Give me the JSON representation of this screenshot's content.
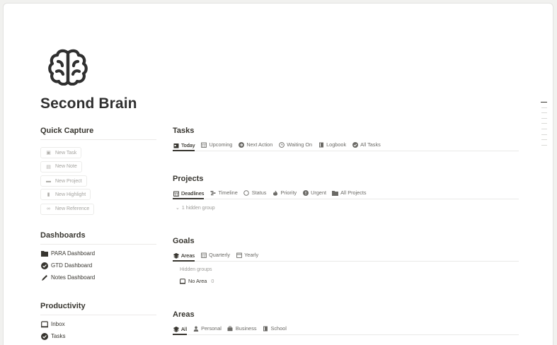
{
  "page": {
    "title": "Second Brain"
  },
  "quick_capture": {
    "heading": "Quick Capture",
    "buttons": [
      {
        "label": "New Task",
        "icon": "checkbox-icon"
      },
      {
        "label": "New Note",
        "icon": "note-icon"
      },
      {
        "label": "New Project",
        "icon": "folder-icon"
      },
      {
        "label": "New Highlight",
        "icon": "bookmark-icon"
      },
      {
        "label": "New Reference",
        "icon": "link-icon"
      }
    ]
  },
  "dashboards": {
    "heading": "Dashboards",
    "items": [
      {
        "label": "PARA Dashboard",
        "icon": "folder-icon"
      },
      {
        "label": "GTD Dashboard",
        "icon": "check-circle-icon"
      },
      {
        "label": "Notes Dashboard",
        "icon": "pencil-icon"
      }
    ]
  },
  "productivity": {
    "heading": "Productivity",
    "items": [
      {
        "label": "Inbox",
        "icon": "inbox-icon"
      },
      {
        "label": "Tasks",
        "icon": "check-circle-icon"
      }
    ]
  },
  "tasks": {
    "title": "Tasks",
    "tabs": [
      {
        "label": "Today",
        "icon": "calendar-icon",
        "active": true
      },
      {
        "label": "Upcoming",
        "icon": "calendar-grid-icon"
      },
      {
        "label": "Next Action",
        "icon": "arrow-circle-icon"
      },
      {
        "label": "Waiting On",
        "icon": "clock-icon"
      },
      {
        "label": "Logbook",
        "icon": "book-icon"
      },
      {
        "label": "All Tasks",
        "icon": "check-circle-icon"
      }
    ]
  },
  "projects": {
    "title": "Projects",
    "tabs": [
      {
        "label": "Deadlines",
        "icon": "calendar-grid-icon",
        "active": true
      },
      {
        "label": "Timeline",
        "icon": "timeline-icon"
      },
      {
        "label": "Status",
        "icon": "circle-icon"
      },
      {
        "label": "Priority",
        "icon": "fire-icon"
      },
      {
        "label": "Urgent",
        "icon": "alert-icon"
      },
      {
        "label": "All Projects",
        "icon": "folder-icon"
      }
    ],
    "hidden_group": "1 hidden group"
  },
  "goals": {
    "title": "Goals",
    "tabs": [
      {
        "label": "Areas",
        "icon": "layers-icon",
        "active": true
      },
      {
        "label": "Quarterly",
        "icon": "calendar-grid-icon"
      },
      {
        "label": "Yearly",
        "icon": "calendar-icon"
      }
    ],
    "hidden_groups_label": "Hidden groups",
    "no_area_label": "No Area",
    "no_area_count": "0"
  },
  "areas": {
    "title": "Areas",
    "tabs": [
      {
        "label": "All",
        "icon": "layers-icon",
        "active": true
      },
      {
        "label": "Personal",
        "icon": "person-icon"
      },
      {
        "label": "Business",
        "icon": "briefcase-icon"
      },
      {
        "label": "School",
        "icon": "book-icon"
      }
    ]
  }
}
